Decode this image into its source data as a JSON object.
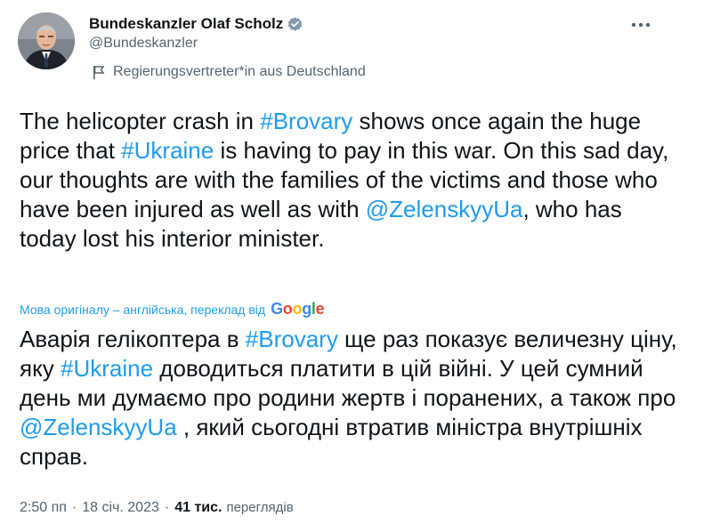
{
  "author": {
    "display_name": "Bundeskanzler Olaf Scholz",
    "handle": "@Bundeskanzler",
    "affiliation_label": "Regierungsvertreter*in aus Deutschland"
  },
  "tweet": {
    "text_segments": [
      {
        "text": "The helicopter crash in ",
        "type": "text"
      },
      {
        "text": "#Brovary",
        "type": "hashtag"
      },
      {
        "text": " shows once again the huge price that ",
        "type": "text"
      },
      {
        "text": "#Ukraine",
        "type": "hashtag"
      },
      {
        "text": " is having to pay in this war. On this sad day, our thoughts are with the families of the victims and those who have been injured as well as with ",
        "type": "text"
      },
      {
        "text": "@ZelenskyyUa",
        "type": "mention"
      },
      {
        "text": ", who has today lost his interior minister.",
        "type": "text"
      }
    ],
    "translation_note": "Мова оригіналу – англійська, переклад від",
    "translation_provider": "Google",
    "translated_segments": [
      {
        "text": "Аварія гелікоптера в ",
        "type": "text"
      },
      {
        "text": "#Brovary",
        "type": "hashtag"
      },
      {
        "text": " ще раз показує величезну ціну, яку ",
        "type": "text"
      },
      {
        "text": "#Ukraine",
        "type": "hashtag"
      },
      {
        "text": " доводиться платити в цій війні. У цей сумний день ми думаємо про родини жертв і поранених, а також про ",
        "type": "text"
      },
      {
        "text": "@ZelenskyyUa",
        "type": "mention"
      },
      {
        "text": " , який сьогодні втратив міністра внутрішніх справ.",
        "type": "text"
      }
    ]
  },
  "meta": {
    "time": "2:50 пп",
    "separator": "·",
    "date": "18 січ. 2023",
    "views_count": "41 тис.",
    "views_label": "переглядів"
  },
  "icons": {
    "verified": "verified-badge-icon",
    "flag": "government-flag-icon",
    "more": "more-options-icon",
    "avatar": "avatar"
  },
  "colors": {
    "accent": "#1d9bf0",
    "text": "#0f1419",
    "secondary": "#536471"
  }
}
